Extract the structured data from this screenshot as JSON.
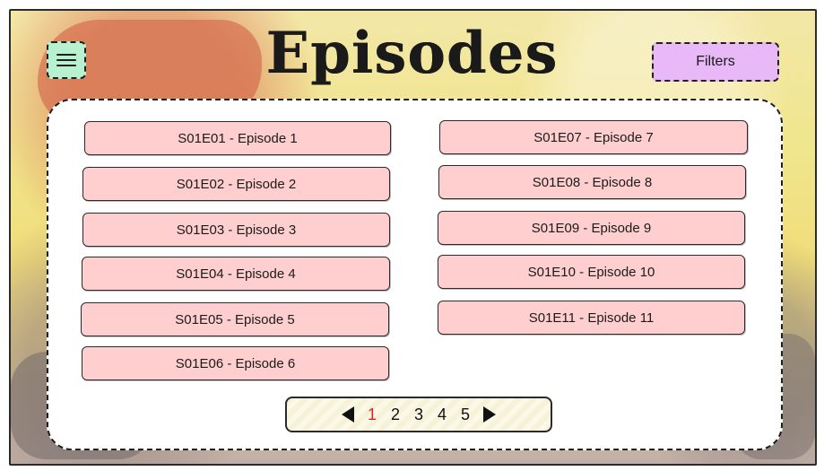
{
  "header": {
    "menu_icon": "hamburger-menu-icon",
    "title": "Episodes",
    "filters_label": "Filters"
  },
  "episodes": {
    "left": [
      "S01E01 - Episode 1",
      "S01E02 - Episode 2",
      "S01E03 - Episode 3",
      "S01E04 - Episode 4",
      "S01E05 - Episode 5",
      "S01E06 - Episode 6"
    ],
    "right": [
      "S01E07 - Episode 7",
      "S01E08 - Episode 8",
      "S01E09 - Episode 9",
      "S01E10 - Episode 10",
      "S01E11 - Episode 11"
    ]
  },
  "pagination": {
    "pages": [
      "1",
      "2",
      "3",
      "4",
      "5"
    ],
    "current_page": "1",
    "prev_icon": "left-triangle-icon",
    "next_icon": "right-triangle-icon"
  },
  "colors": {
    "episode_button": "#ffcfcf",
    "menu_button": "#b7f1cf",
    "filters_button": "#e8b9f6",
    "current_page": "#d22222"
  }
}
